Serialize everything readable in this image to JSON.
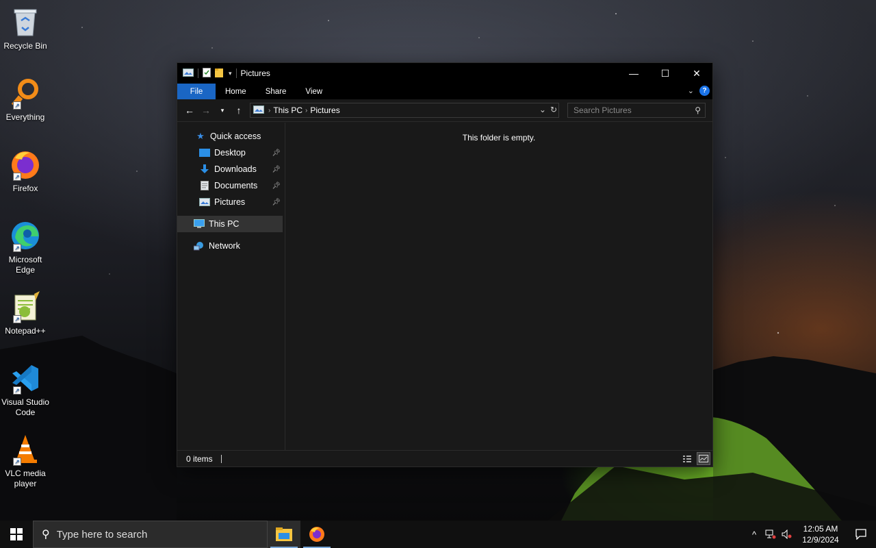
{
  "desktop": {
    "icons": [
      {
        "label": "Recycle Bin",
        "icon": "recycle-bin-icon"
      },
      {
        "label": "Everything",
        "icon": "everything-icon"
      },
      {
        "label": "Firefox",
        "icon": "firefox-icon"
      },
      {
        "label": "Microsoft Edge",
        "icon": "edge-icon"
      },
      {
        "label": "Notepad++",
        "icon": "notepadpp-icon"
      },
      {
        "label": "Visual Studio Code",
        "icon": "vscode-icon"
      },
      {
        "label": "VLC media player",
        "icon": "vlc-icon"
      }
    ]
  },
  "explorer": {
    "title": "Pictures",
    "ribbon_tabs": {
      "file": "File",
      "home": "Home",
      "share": "Share",
      "view": "View"
    },
    "help_label": "?",
    "address": {
      "this_pc": "This PC",
      "current": "Pictures"
    },
    "search_placeholder": "Search Pictures",
    "nav": {
      "quick_access": "Quick access",
      "desktop": "Desktop",
      "downloads": "Downloads",
      "documents": "Documents",
      "pictures": "Pictures",
      "this_pc": "This PC",
      "network": "Network"
    },
    "empty_message": "This folder is empty.",
    "status": {
      "items": "0 items"
    }
  },
  "taskbar": {
    "search_placeholder": "Type here to search",
    "apps": [
      {
        "name": "File Explorer",
        "icon": "file-explorer-icon",
        "active": true
      },
      {
        "name": "Firefox",
        "icon": "firefox-icon",
        "active": false
      }
    ],
    "clock": {
      "time": "12:05 AM",
      "date": "12/9/2024"
    }
  },
  "colors": {
    "accent": "#1a66c4",
    "window_bg": "#191919",
    "titlebar_bg": "#000000",
    "taskbar_bg": "#101010"
  }
}
